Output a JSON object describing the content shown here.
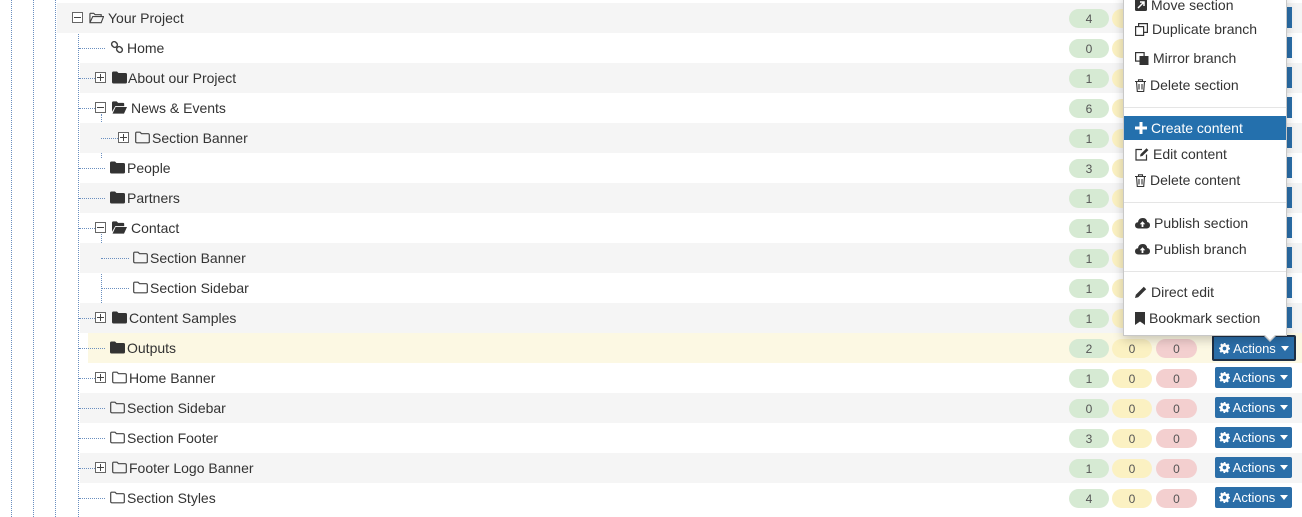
{
  "tree": {
    "rows": [
      {
        "label": "Your Project",
        "counts": [
          "4",
          "",
          ""
        ],
        "action": ""
      },
      {
        "label": "Home",
        "counts": [
          "0",
          "",
          ""
        ],
        "action": ""
      },
      {
        "label": "About our Project",
        "counts": [
          "1",
          "",
          ""
        ],
        "action": ""
      },
      {
        "label": "News & Events",
        "counts": [
          "6",
          "",
          ""
        ],
        "action": ""
      },
      {
        "label": "Section Banner",
        "counts": [
          "1",
          "",
          ""
        ],
        "action": ""
      },
      {
        "label": "People",
        "counts": [
          "3",
          "",
          ""
        ],
        "action": ""
      },
      {
        "label": "Partners",
        "counts": [
          "1",
          "",
          ""
        ],
        "action": ""
      },
      {
        "label": "Contact",
        "counts": [
          "1",
          "",
          ""
        ],
        "action": ""
      },
      {
        "label": "Section Banner",
        "counts": [
          "1",
          "",
          ""
        ],
        "action": ""
      },
      {
        "label": "Section Sidebar",
        "counts": [
          "1",
          "",
          ""
        ],
        "action": ""
      },
      {
        "label": "Content Samples",
        "counts": [
          "1",
          "",
          ""
        ],
        "action": ""
      },
      {
        "label": "Outputs",
        "counts": [
          "2",
          "0",
          "0"
        ],
        "action": "Actions"
      },
      {
        "label": "Home Banner",
        "counts": [
          "1",
          "0",
          "0"
        ],
        "action": "Actions"
      },
      {
        "label": "Section Sidebar",
        "counts": [
          "0",
          "0",
          "0"
        ],
        "action": "Actions"
      },
      {
        "label": "Section Footer",
        "counts": [
          "3",
          "0",
          "0"
        ],
        "action": "Actions"
      },
      {
        "label": "Footer Logo Banner",
        "counts": [
          "1",
          "0",
          "0"
        ],
        "action": "Actions"
      },
      {
        "label": "Section Styles",
        "counts": [
          "4",
          "0",
          "0"
        ],
        "action": "Actions"
      }
    ]
  },
  "menu": {
    "items": [
      {
        "label": "Move section",
        "icon": "move-icon"
      },
      {
        "label": "Duplicate branch",
        "icon": "duplicate-icon"
      },
      {
        "label": "Mirror branch",
        "icon": "mirror-icon"
      },
      {
        "label": "Delete section",
        "icon": "trash-icon"
      },
      {
        "label": "Create content",
        "icon": "plus-icon",
        "active": true
      },
      {
        "label": "Edit content",
        "icon": "edit-icon"
      },
      {
        "label": "Delete content",
        "icon": "trash-icon"
      },
      {
        "label": "Publish section",
        "icon": "cloud-upload-icon"
      },
      {
        "label": "Publish branch",
        "icon": "cloud-upload-icon"
      },
      {
        "label": "Direct edit",
        "icon": "pencil-icon"
      },
      {
        "label": "Bookmark section",
        "icon": "bookmark-icon"
      }
    ]
  },
  "colors": {
    "accent": "#2b6ea8",
    "menu_active": "#2470ad",
    "selected_row": "#fcf8e3",
    "badge_green": "#d6ead3",
    "badge_yellow": "#fbf1c2",
    "badge_red": "#f3cfcf"
  }
}
